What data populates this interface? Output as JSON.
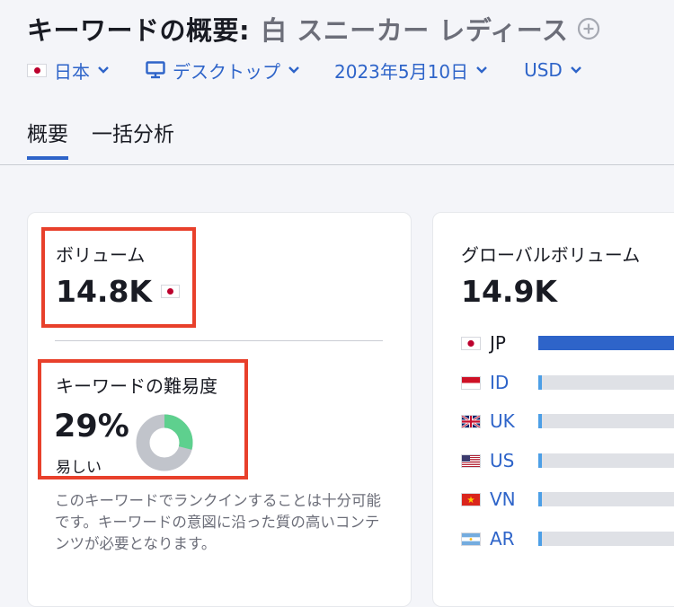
{
  "header": {
    "title": "キーワードの概要:",
    "keyword": "白 スニーカー レディース"
  },
  "filters": {
    "database": "日本",
    "device": "デスクトップ",
    "date": "2023年5月10日",
    "currency": "USD"
  },
  "tabs": [
    {
      "label": "概要",
      "active": true
    },
    {
      "label": "一括分析",
      "active": false
    }
  ],
  "volume": {
    "label": "ボリューム",
    "value": "14.8K"
  },
  "keyword_difficulty": {
    "label": "キーワードの難易度",
    "value": "29%",
    "level": "易しい",
    "percent": 29,
    "description": "このキーワードでランクインすることは十分可能です。キーワードの意図に沿った質の高いコンテンツが必要となります。",
    "colors": {
      "filled": "#5ed08e",
      "empty": "#c1c4cb"
    }
  },
  "global_volume": {
    "label": "グローバルボリューム",
    "value": "14.9K",
    "countries": [
      {
        "code": "JP",
        "flag": "jp-flag",
        "share": 1.0,
        "link": false
      },
      {
        "code": "ID",
        "flag": "id-flag",
        "share": 0.02,
        "link": true
      },
      {
        "code": "UK",
        "flag": "uk-flag",
        "share": 0.02,
        "link": true
      },
      {
        "code": "US",
        "flag": "us-flag",
        "share": 0.02,
        "link": true
      },
      {
        "code": "VN",
        "flag": "vn-flag",
        "share": 0.02,
        "link": true
      },
      {
        "code": "AR",
        "flag": "ar-flag",
        "share": 0.02,
        "link": true
      }
    ]
  },
  "colors": {
    "accent": "#2e64c9",
    "highlight": "#e8402b",
    "page_bg": "#f4f5f9"
  }
}
